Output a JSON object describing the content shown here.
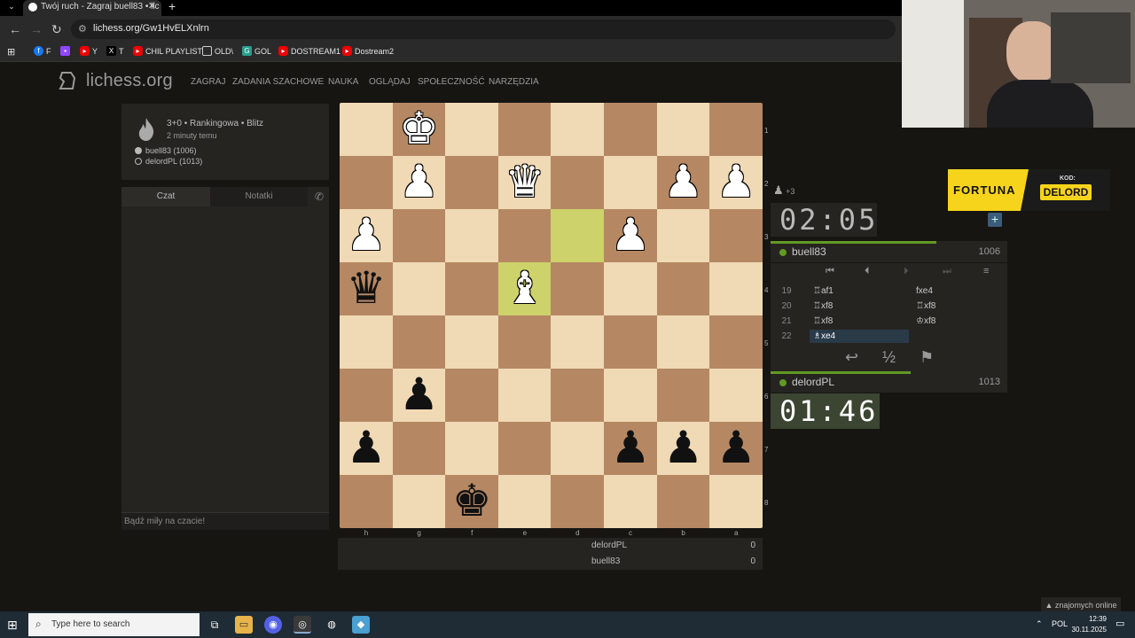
{
  "browser": {
    "tab_title": "Twój ruch - Zagraj buell83 • lic",
    "url": "lichess.org/Gw1HvELXnlrn",
    "bookmarks": [
      {
        "label": "F",
        "icon": "facebook-icon"
      },
      {
        "label": "",
        "icon": "twitch-icon"
      },
      {
        "label": "Y",
        "icon": "youtube-icon"
      },
      {
        "label": "T",
        "icon": "x-icon"
      },
      {
        "label": "CHIL PLAYLIST",
        "icon": "youtube-icon"
      },
      {
        "label": "OLD\\",
        "icon": "folder-icon"
      },
      {
        "label": "GOL",
        "icon": "gol-icon"
      },
      {
        "label": "DOSTREAM1",
        "icon": "youtube-icon"
      },
      {
        "label": "Dostream2",
        "icon": "youtube-icon"
      }
    ]
  },
  "site": {
    "name": "lichess.org",
    "nav": [
      "ZAGRAJ",
      "ZADANIA SZACHOWE",
      "NAUKA",
      "OGLĄDAJ",
      "SPOŁECZNOŚĆ",
      "NARZĘDZIA"
    ]
  },
  "game_info": {
    "title": "3+0 • Rankingowa • Blitz",
    "time_ago": "2 minuty temu",
    "white": "buell83 (1006)",
    "black": "delordPL (1013)"
  },
  "chat": {
    "tab_chat": "Czat",
    "tab_notes": "Notatki",
    "placeholder": "Bądź miły na czacie!"
  },
  "board": {
    "files": [
      "h",
      "g",
      "f",
      "e",
      "d",
      "c",
      "b",
      "a"
    ],
    "ranks": [
      "1",
      "2",
      "3",
      "4",
      "5",
      "6",
      "7",
      "8"
    ],
    "orientation": "black",
    "last_move_squares": [
      "e4",
      "d3"
    ],
    "pieces": [
      {
        "square": "g1",
        "piece": "K",
        "color": "white"
      },
      {
        "square": "g2",
        "piece": "P",
        "color": "white"
      },
      {
        "square": "e2",
        "piece": "Q",
        "color": "white"
      },
      {
        "square": "b2",
        "piece": "P",
        "color": "white"
      },
      {
        "square": "a2",
        "piece": "P",
        "color": "white"
      },
      {
        "square": "h3",
        "piece": "P",
        "color": "white"
      },
      {
        "square": "c3",
        "piece": "P",
        "color": "white"
      },
      {
        "square": "h4",
        "piece": "Q",
        "color": "black"
      },
      {
        "square": "e4",
        "piece": "B",
        "color": "white"
      },
      {
        "square": "g6",
        "piece": "P",
        "color": "black"
      },
      {
        "square": "h7",
        "piece": "P",
        "color": "black"
      },
      {
        "square": "c7",
        "piece": "P",
        "color": "black"
      },
      {
        "square": "b7",
        "piece": "P",
        "color": "black"
      },
      {
        "square": "a7",
        "piece": "P",
        "color": "black"
      },
      {
        "square": "f8",
        "piece": "K",
        "color": "black"
      }
    ]
  },
  "material": {
    "top_name": "delordPL",
    "top_score": "0",
    "bottom_name": "buell83",
    "bottom_score": "0"
  },
  "opponent": {
    "captured": "+3",
    "clock": "02:05",
    "name": "buell83",
    "rating": "1006",
    "time_fraction": 0.7
  },
  "player": {
    "clock": "01:46",
    "name": "delordPL",
    "rating": "1013",
    "time_fraction": 0.59
  },
  "moves": [
    {
      "num": "19",
      "white": "♖af1",
      "black": "fxe4"
    },
    {
      "num": "20",
      "white": "♖xf8",
      "black": "♖xf8"
    },
    {
      "num": "21",
      "white": "♖xf8",
      "black": "♔xf8"
    },
    {
      "num": "22",
      "white": "♗xe4",
      "black": ""
    }
  ],
  "ad": {
    "brand": "FORTUNA",
    "code_label": "KOD:",
    "code": "DELORD"
  },
  "friends": "▲ znajomych online",
  "taskbar": {
    "search": "Type here to search",
    "lang": "POL",
    "time": "12:39",
    "date": "30.11.2025"
  }
}
